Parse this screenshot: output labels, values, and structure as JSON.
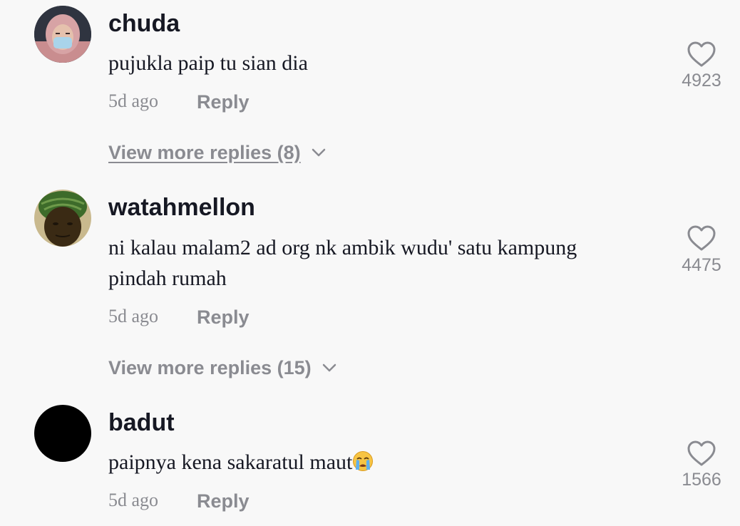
{
  "comments": [
    {
      "username": "chuda",
      "text": "pujukla paip tu sian dia",
      "time": "5d ago",
      "reply_label": "Reply",
      "likes": "4923",
      "view_more": "View more replies (8)"
    },
    {
      "username": "watahmellon",
      "text": "ni kalau malam2 ad org nk ambik wudu' satu kampung pindah rumah",
      "time": "5d ago",
      "reply_label": "Reply",
      "likes": "4475",
      "view_more": "View more replies (15)"
    },
    {
      "username": "badut",
      "text": "paipnya kena sakaratul maut",
      "text_emoji": "😭",
      "time": "5d ago",
      "reply_label": "Reply",
      "likes": "1566"
    }
  ],
  "colors": {
    "background": "#f8f8f8",
    "text_primary": "#161823",
    "text_secondary": "#8a8b91"
  }
}
